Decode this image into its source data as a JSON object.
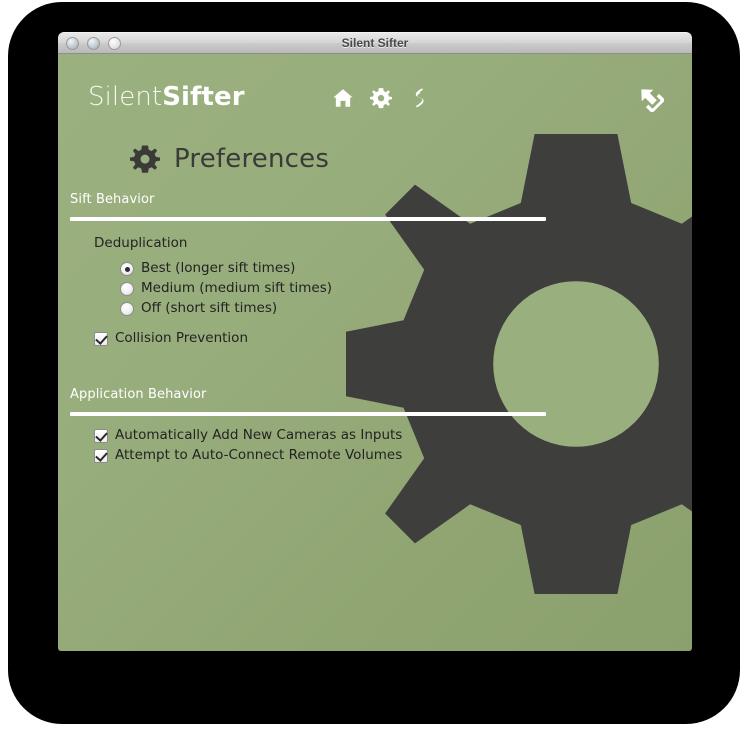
{
  "window": {
    "title": "Silent Sifter",
    "traffic_lights": [
      {
        "name": "close",
        "label": "Close"
      },
      {
        "name": "minimize",
        "label": "Minimize"
      },
      {
        "name": "zoom",
        "label": "Zoom"
      }
    ]
  },
  "brand": {
    "thin": "Silent",
    "bold": "Sifter"
  },
  "toolbar": {
    "items": [
      {
        "icon": "home-icon",
        "label": "Home"
      },
      {
        "icon": "gear-icon",
        "label": "Preferences"
      },
      {
        "icon": "sift-bolt-icon",
        "label": "Sift"
      }
    ],
    "export": {
      "icon": "export-arrow-icon",
      "label": "Export"
    }
  },
  "page": {
    "icon": "gear-icon",
    "title": "Preferences"
  },
  "sections": [
    {
      "id": "sift-behavior",
      "title": "Sift Behavior",
      "group_label": "Deduplication",
      "radios": [
        {
          "id": "dedup-best",
          "label": "Best (longer sift times)",
          "checked": true
        },
        {
          "id": "dedup-medium",
          "label": "Medium (medium sift times)",
          "checked": false
        },
        {
          "id": "dedup-off",
          "label": "Off (short sift times)",
          "checked": false
        }
      ],
      "checkboxes": [
        {
          "id": "collision-prevention",
          "label": "Collision Prevention",
          "checked": true
        }
      ]
    },
    {
      "id": "application-behavior",
      "title": "Application Behavior",
      "group_label": "",
      "radios": [],
      "checkboxes": [
        {
          "id": "auto-add-cameras",
          "label": "Automatically Add New Cameras as Inputs",
          "checked": true
        },
        {
          "id": "auto-connect-vols",
          "label": "Attempt to Auto-Connect Remote Volumes",
          "checked": true
        }
      ]
    }
  ],
  "colors": {
    "bg_light": "#9bb07f",
    "bg_dark": "#8ba16d",
    "gear_dark": "#3e3e3d",
    "rule": "#ffffff",
    "text_dark": "#232322",
    "text_light": "#ffffff",
    "backdrop": "#000000"
  }
}
